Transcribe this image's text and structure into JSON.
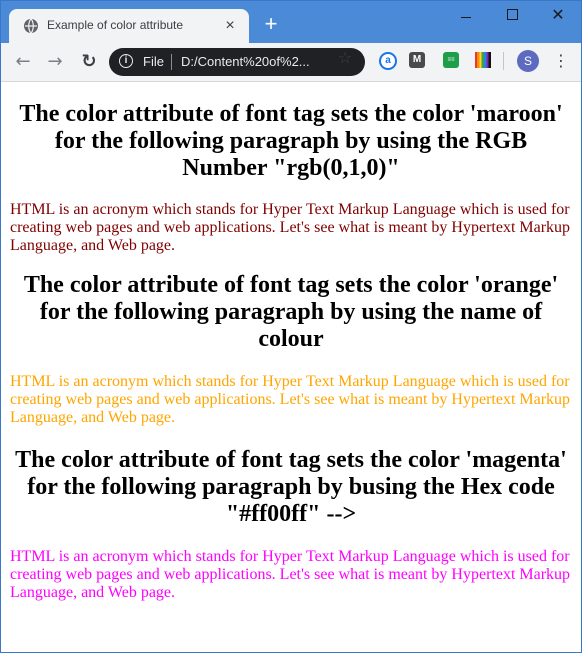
{
  "browser": {
    "tab_title": "Example of color attribute",
    "tab_close": "×",
    "new_tab": "+",
    "window_close": "✕",
    "scheme": "File",
    "url": "D:/Content%20of%2...",
    "avatar_letter": "S",
    "ext_a_label": "a",
    "ext_m_label": "M",
    "ext_sheet_label": "≡≡",
    "ext_bars_label": "",
    "back_glyph": "←",
    "forward_glyph": "→",
    "reload_glyph": "↻",
    "star_glyph": "☆",
    "menu_glyph": "⋮",
    "info_glyph": "i",
    "icons": [
      "globe-icon",
      "info-icon",
      "star-icon",
      "kebab-menu-icon"
    ]
  },
  "page": {
    "sections": [
      {
        "heading": "The color attribute of font tag sets the color 'maroon' for the following paragraph by using the RGB Number \"rgb(0,1,0)\"",
        "paragraph": "HTML is an acronym which stands for Hyper Text Markup Language which is used for creating web pages and web applications. Let's see what is meant by Hypertext Markup Language, and Web page.",
        "color": "#800000"
      },
      {
        "heading": "The color attribute of font tag sets the color 'orange' for the following paragraph by using the name of colour",
        "paragraph": "HTML is an acronym which stands for Hyper Text Markup Language which is used for creating web pages and web applications. Let's see what is meant by Hypertext Markup Language, and Web page.",
        "color": "#ffa500"
      },
      {
        "heading": "The color attribute of font tag sets the color 'magenta' for the following paragraph by busing the Hex code \"#ff00ff\" -->",
        "paragraph": "HTML is an acronym which stands for Hyper Text Markup Language which is used for creating web pages and web applications. Let's see what is meant by Hypertext Markup Language, and Web page.",
        "color": "#ff00ff"
      }
    ]
  },
  "colors": {
    "titlebar": "#4a8ad6",
    "tab_bg": "#f1f3f4",
    "omnibox_bg": "#202124"
  }
}
